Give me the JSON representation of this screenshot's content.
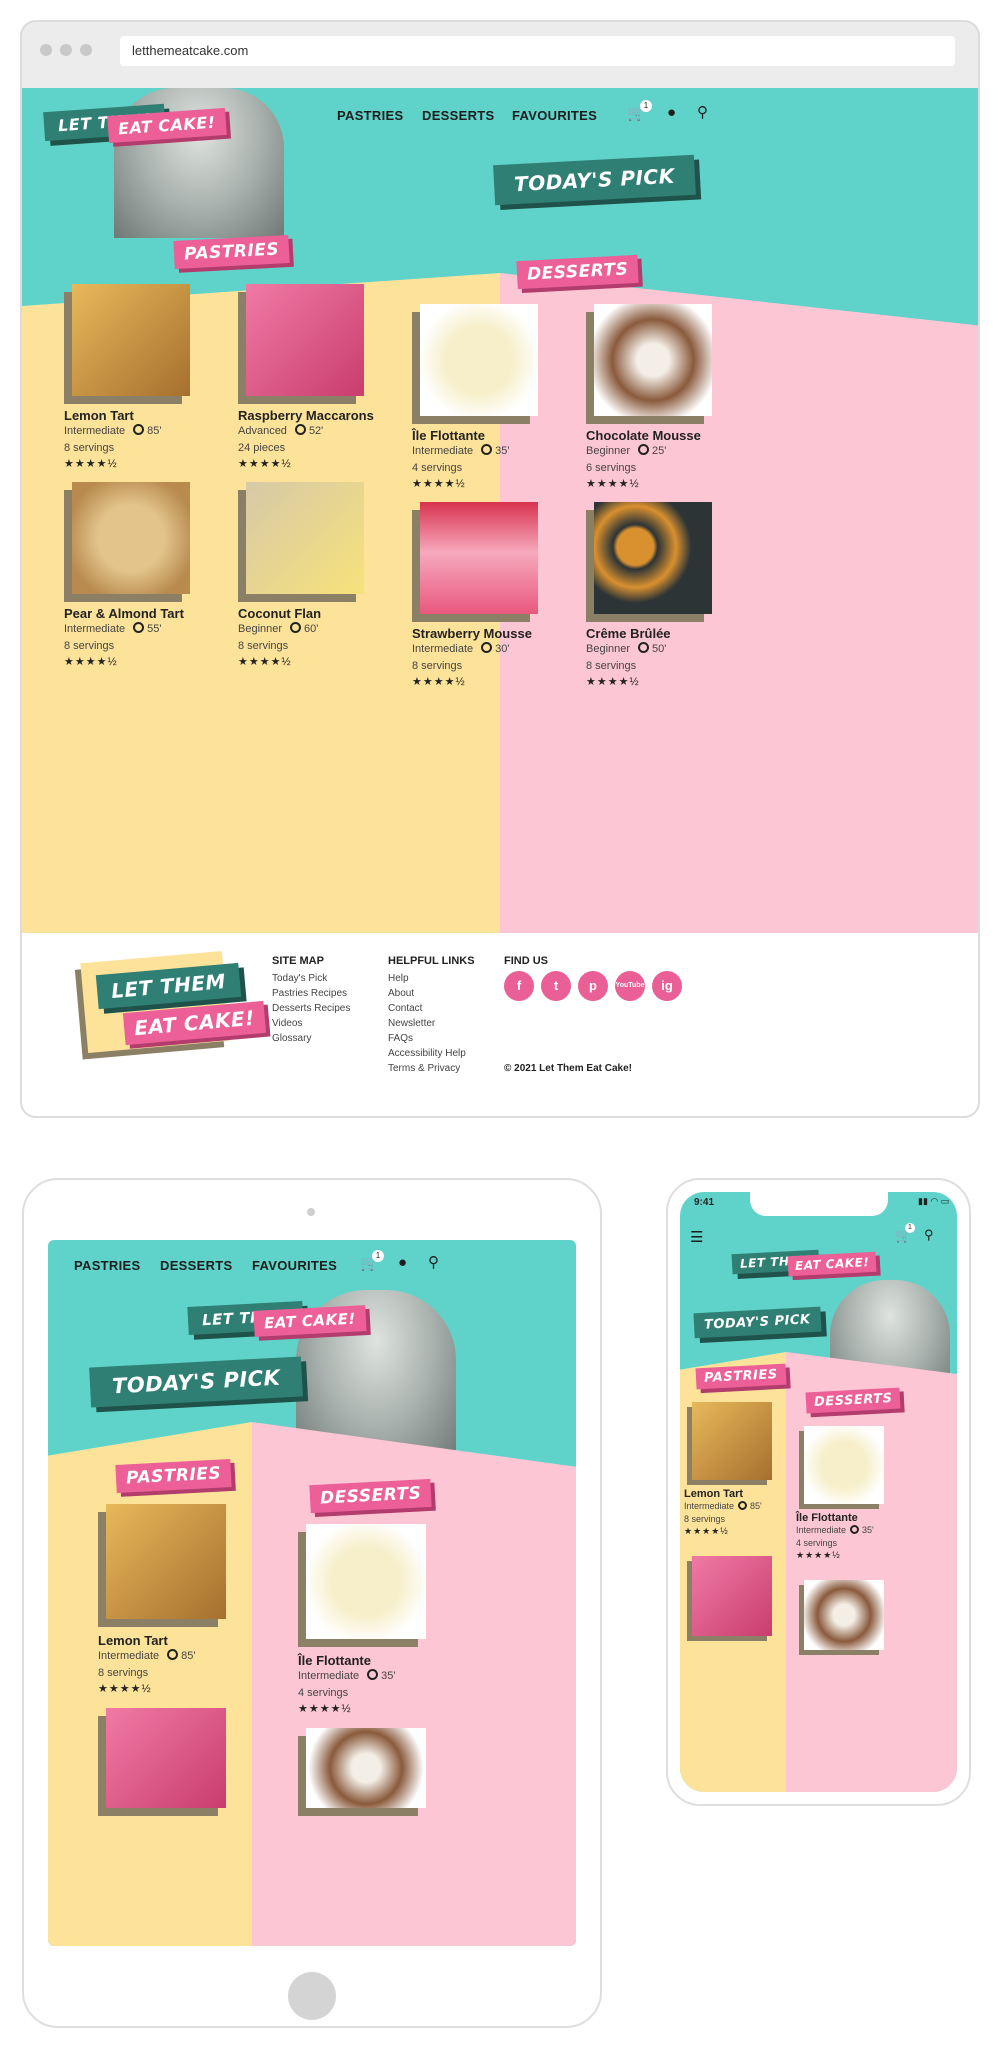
{
  "browser": {
    "url": "letthemeatcake.com"
  },
  "brand": {
    "line1": "LET THEM",
    "line2": "EAT CAKE!"
  },
  "nav": {
    "pastries": "PASTRIES",
    "desserts": "DESSERTS",
    "favourites": "FAVOURITES",
    "cart_count": "1"
  },
  "hero": {
    "title": "TODAY'S PICK"
  },
  "sections": {
    "pastries": "PASTRIES",
    "desserts": "DESSERTS"
  },
  "pastries": [
    {
      "name": "Lemon Tart",
      "level": "Intermediate",
      "time": "85'",
      "yield": "8 servings",
      "rating": "★★★★½",
      "img_a": "#e7b95a",
      "img_b": "#a66f2f"
    },
    {
      "name": "Raspberry Maccarons",
      "level": "Advanced",
      "time": "52'",
      "yield": "24 pieces",
      "rating": "★★★★½",
      "img_a": "#f07aa5",
      "img_b": "#c93d6e"
    },
    {
      "name": "Pear & Almond Tart",
      "level": "Intermediate",
      "time": "55'",
      "yield": "8 servings",
      "rating": "★★★★½",
      "img_a": "#e3c58c",
      "img_b": "#b88a4e"
    },
    {
      "name": "Coconut Flan",
      "level": "Beginner",
      "time": "60'",
      "yield": "8 servings",
      "rating": "★★★★½",
      "img_a": "#f7e27a",
      "img_b": "#d7c9a8"
    }
  ],
  "desserts": [
    {
      "name": "Île Flottante",
      "level": "Intermediate",
      "time": "35'",
      "yield": "4 servings",
      "rating": "★★★★½",
      "img_a": "#f6efc9",
      "img_b": "#e0cf8c"
    },
    {
      "name": "Chocolate Mousse",
      "level": "Beginner",
      "time": "25'",
      "yield": "6 servings",
      "rating": "★★★★½",
      "img_a": "#8a5a3c",
      "img_b": "#f3eee6"
    },
    {
      "name": "Strawberry Mousse",
      "level": "Intermediate",
      "time": "30'",
      "yield": "8 servings",
      "rating": "★★★★½",
      "img_a": "#f6a9bd",
      "img_b": "#d8334f"
    },
    {
      "name": "Crême Brûlée",
      "level": "Beginner",
      "time": "50'",
      "yield": "8 servings",
      "rating": "★★★★½",
      "img_a": "#d9902f",
      "img_b": "#2c3436"
    }
  ],
  "footer": {
    "sitemap_title": "SITE MAP",
    "sitemap": [
      "Today's Pick",
      "Pastries Recipes",
      "Desserts Recipes",
      "Videos",
      "Glossary"
    ],
    "helpful_title": "HELPFUL LINKS",
    "helpful": [
      "Help",
      "About",
      "Contact",
      "Newsletter",
      "FAQs",
      "Accessibility Help",
      "Terms & Privacy"
    ],
    "find_title": "FIND US",
    "social": [
      "f",
      "t",
      "p",
      "YouTube",
      "ig"
    ],
    "copyright": "© 2021 Let Them Eat Cake!"
  },
  "phone": {
    "time": "9:41"
  },
  "colors": {
    "teal": "#5fd3c9",
    "yellow": "#fde39a",
    "pink": "#fcc6d5",
    "accent_pink": "#ec5f97",
    "dark_teal": "#2f7f74"
  }
}
